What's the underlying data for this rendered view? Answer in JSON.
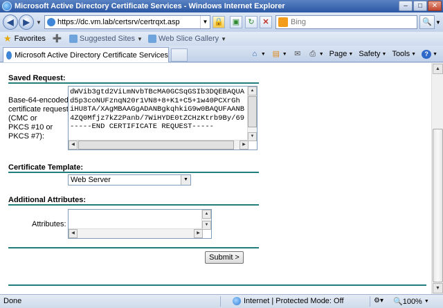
{
  "window": {
    "title": "Microsoft Active Directory Certificate Services - Windows Internet Explorer"
  },
  "address": {
    "url": "https://dc.vm.lab/certsrv/certrqxt.asp",
    "search_placeholder": "Bing"
  },
  "favorites_bar": {
    "favorites_label": "Favorites",
    "items": [
      "Suggested Sites",
      "Web Slice Gallery"
    ]
  },
  "tab": {
    "title": "Microsoft Active Directory Certificate Services"
  },
  "command_bar": {
    "page_label": "Page",
    "safety_label": "Safety",
    "tools_label": "Tools"
  },
  "form": {
    "saved_request_heading": "Saved Request:",
    "saved_request_label": "Base-64-encoded\ncertificate request\n(CMC or\nPKCS #10 or\nPKCS #7):",
    "request_text": "dWVib3gtd2ViLmNvbTBcMA0GCSqGSIb3DQEBAQUA\nd5p3coNUFznqN20r1VN8+8+K1+C5+1w40PCXrGh\niHU8TA/XAgMBAAGgADANBgkqhkiG9w0BAQUFAANB\n4ZQ0Mfjz7kZ2Panb/7WiHYDE0tZCHzKtrb9By/69\n-----END CERTIFICATE REQUEST-----",
    "template_heading": "Certificate Template:",
    "template_value": "Web Server",
    "additional_heading": "Additional Attributes:",
    "attributes_label": "Attributes:",
    "submit_label": "Submit >"
  },
  "status_bar": {
    "status": "Done",
    "zone": "Internet | Protected Mode: Off",
    "zoom": "100%"
  }
}
